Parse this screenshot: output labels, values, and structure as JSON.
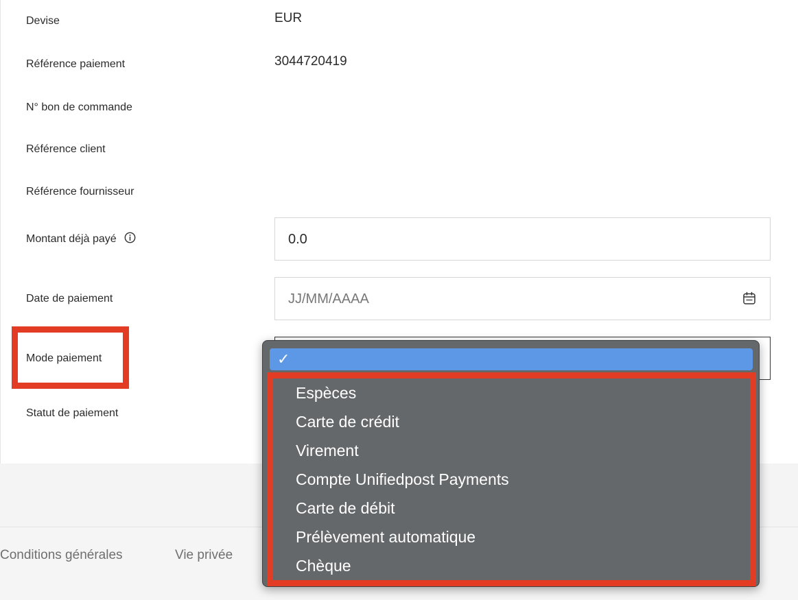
{
  "form": {
    "devise_label": "Devise",
    "devise_value": "EUR",
    "ref_paiement_label": "Référence paiement",
    "ref_paiement_value": "3044720419",
    "bon_commande_label": "N° bon de commande",
    "ref_client_label": "Référence client",
    "ref_fournisseur_label": "Référence fournisseur",
    "montant_label": "Montant déjà payé",
    "montant_value": "0.0",
    "date_label": "Date de paiement",
    "date_placeholder": "JJ/MM/AAAA",
    "mode_label": "Mode paiement",
    "statut_label": "Statut de paiement"
  },
  "dropdown": {
    "selected_mark": "✓",
    "options": [
      "Espèces",
      "Carte de crédit",
      "Virement",
      "Compte Unifiedpost Payments",
      "Carte de débit",
      "Prélèvement automatique",
      "Chèque"
    ]
  },
  "footer": {
    "conditions": "Conditions générales",
    "privacy": "Vie privée"
  },
  "colors": {
    "highlight": "#e23c24",
    "dropdown_bg": "#65686b",
    "dropdown_selected": "#5d98e6"
  },
  "icons": {
    "info": "info-icon",
    "calendar": "calendar-icon",
    "check": "checkmark-icon"
  }
}
